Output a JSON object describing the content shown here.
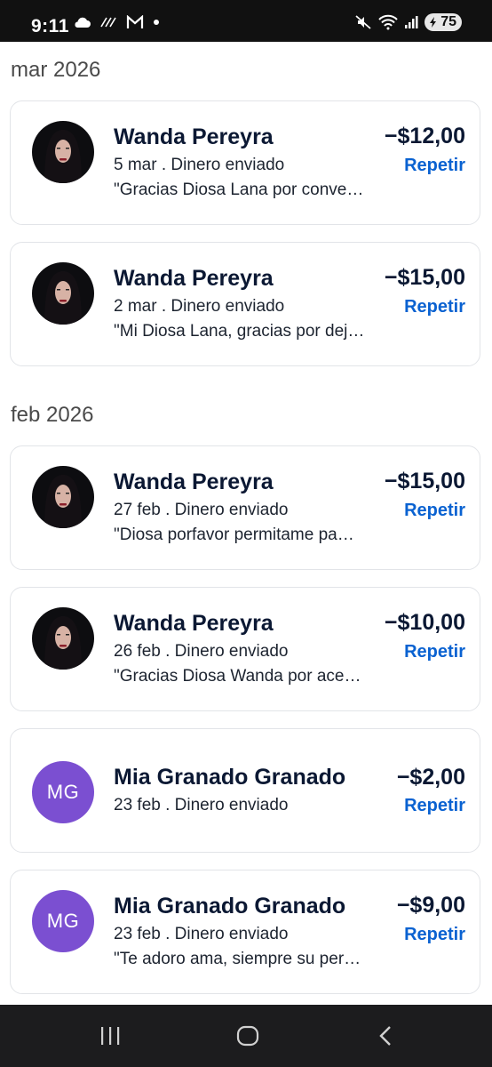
{
  "status_bar": {
    "time": "9:11",
    "left_icons": [
      "cloud-icon",
      "no-wifi-calling-icon",
      "gmail-icon",
      "notification-dot-icon"
    ],
    "right_icons": [
      "mute-icon",
      "wifi-icon",
      "signal-icon"
    ],
    "battery": "75"
  },
  "sections": [
    {
      "month": "mar 2026",
      "transactions": [
        {
          "name": "Wanda Pereyra",
          "amount": "−$12,00",
          "date_type": "5 mar . Dinero enviado",
          "note": "\"Gracias Diosa Lana por conve…",
          "repeat": "Repetir",
          "avatar": "photo"
        },
        {
          "name": "Wanda Pereyra",
          "amount": "−$15,00",
          "date_type": "2 mar . Dinero enviado",
          "note": "\"Mi Diosa Lana, gracias por dej…",
          "repeat": "Repetir",
          "avatar": "photo"
        }
      ]
    },
    {
      "month": "feb 2026",
      "transactions": [
        {
          "name": "Wanda Pereyra",
          "amount": "−$15,00",
          "date_type": "27 feb . Dinero enviado",
          "note": "\"Diosa porfavor permitame pa…",
          "repeat": "Repetir",
          "avatar": "photo"
        },
        {
          "name": "Wanda Pereyra",
          "amount": "−$10,00",
          "date_type": "26 feb . Dinero enviado",
          "note": "\"Gracias Diosa Wanda por ace…",
          "repeat": "Repetir",
          "avatar": "photo"
        },
        {
          "name": "Mia Granado Granado",
          "amount": "−$2,00",
          "date_type": "23 feb . Dinero enviado",
          "note": "",
          "repeat": "Repetir",
          "avatar": "MG"
        },
        {
          "name": "Mia Granado Granado",
          "amount": "−$9,00",
          "date_type": "23 feb . Dinero enviado",
          "note": "\"Te adoro ama, siempre su per…",
          "repeat": "Repetir",
          "avatar": "MG"
        }
      ]
    }
  ],
  "nav_bar": {
    "buttons": [
      "recent-apps-icon",
      "home-icon",
      "back-icon"
    ]
  },
  "colors": {
    "accent": "#0a62d1",
    "text_primary": "#0b1833",
    "avatar_initials_bg": "#7b4fd1",
    "status_bar_bg": "#111111",
    "nav_bar_bg": "#1c1c1e"
  }
}
